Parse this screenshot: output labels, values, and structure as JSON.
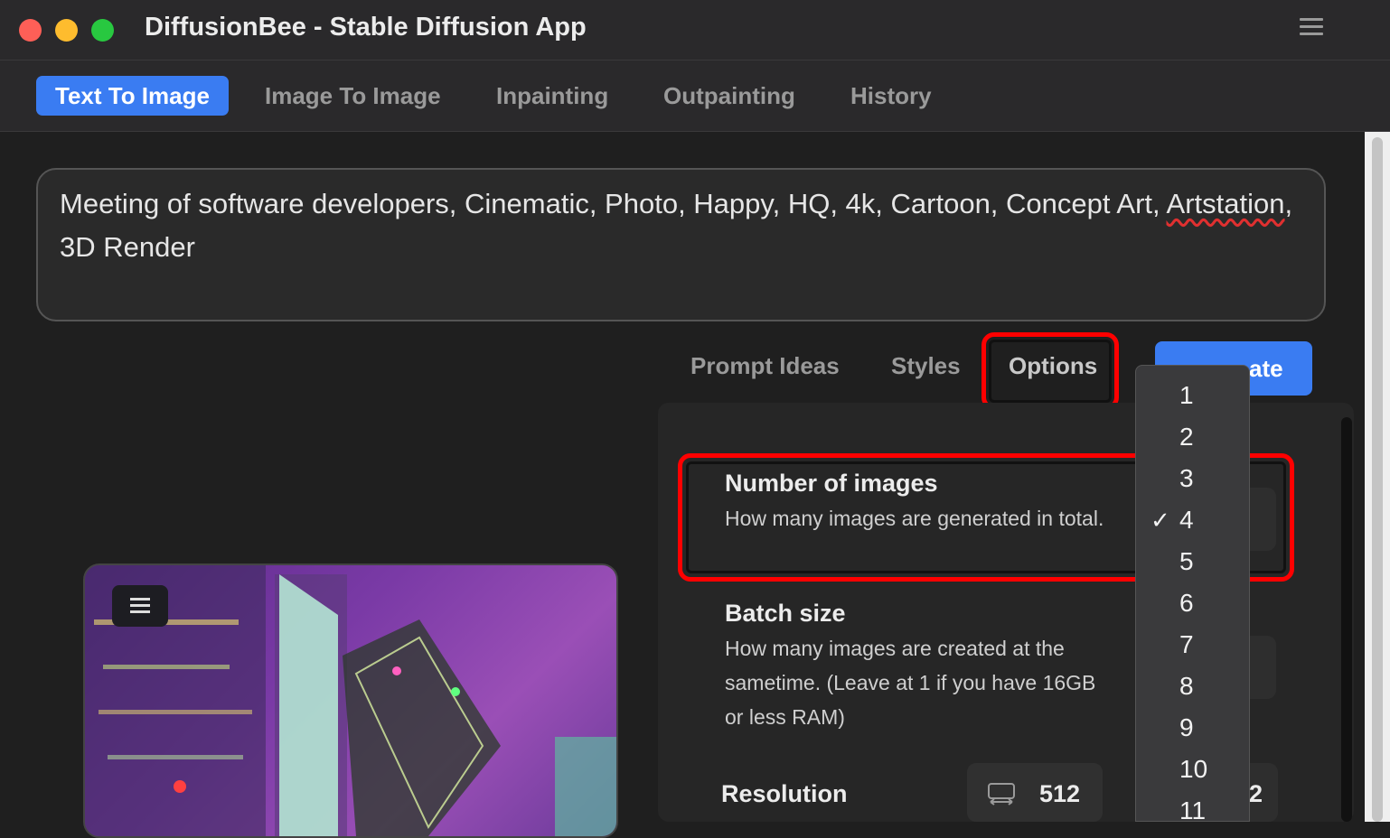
{
  "window": {
    "title": "DiffusionBee - Stable Diffusion App"
  },
  "tabs": [
    {
      "label": "Text To Image",
      "active": true
    },
    {
      "label": "Image To Image",
      "active": false
    },
    {
      "label": "Inpainting",
      "active": false
    },
    {
      "label": "Outpainting",
      "active": false
    },
    {
      "label": "History",
      "active": false
    }
  ],
  "prompt": {
    "text_before": "Meeting of software developers, Cinematic, Photo, Happy, HQ, 4k, Cartoon, Concept Art, ",
    "misspelled_word": "Artstation",
    "text_after": ", 3D Render"
  },
  "sub_tabs": {
    "prompt_ideas": "Prompt Ideas",
    "styles": "Styles",
    "options": "Options"
  },
  "generate_button": {
    "label": "ate"
  },
  "options": {
    "num_images": {
      "title": "Number of images",
      "description": "How many images are generated in total."
    },
    "batch_size": {
      "title": "Batch size",
      "description": "How many images are created at the sametime. (Leave at 1 if you have 16GB or less RAM)"
    },
    "resolution": {
      "title": "Resolution",
      "width": "512",
      "height_partial": "2"
    }
  },
  "dropdown": {
    "items": [
      "1",
      "2",
      "3",
      "4",
      "5",
      "6",
      "7",
      "8",
      "9",
      "10",
      "11"
    ],
    "selected": "4",
    "check_mark": "✓"
  },
  "colors": {
    "accent": "#3a7cf2",
    "highlight": "#ff0000",
    "background": "#1f1f1f"
  }
}
